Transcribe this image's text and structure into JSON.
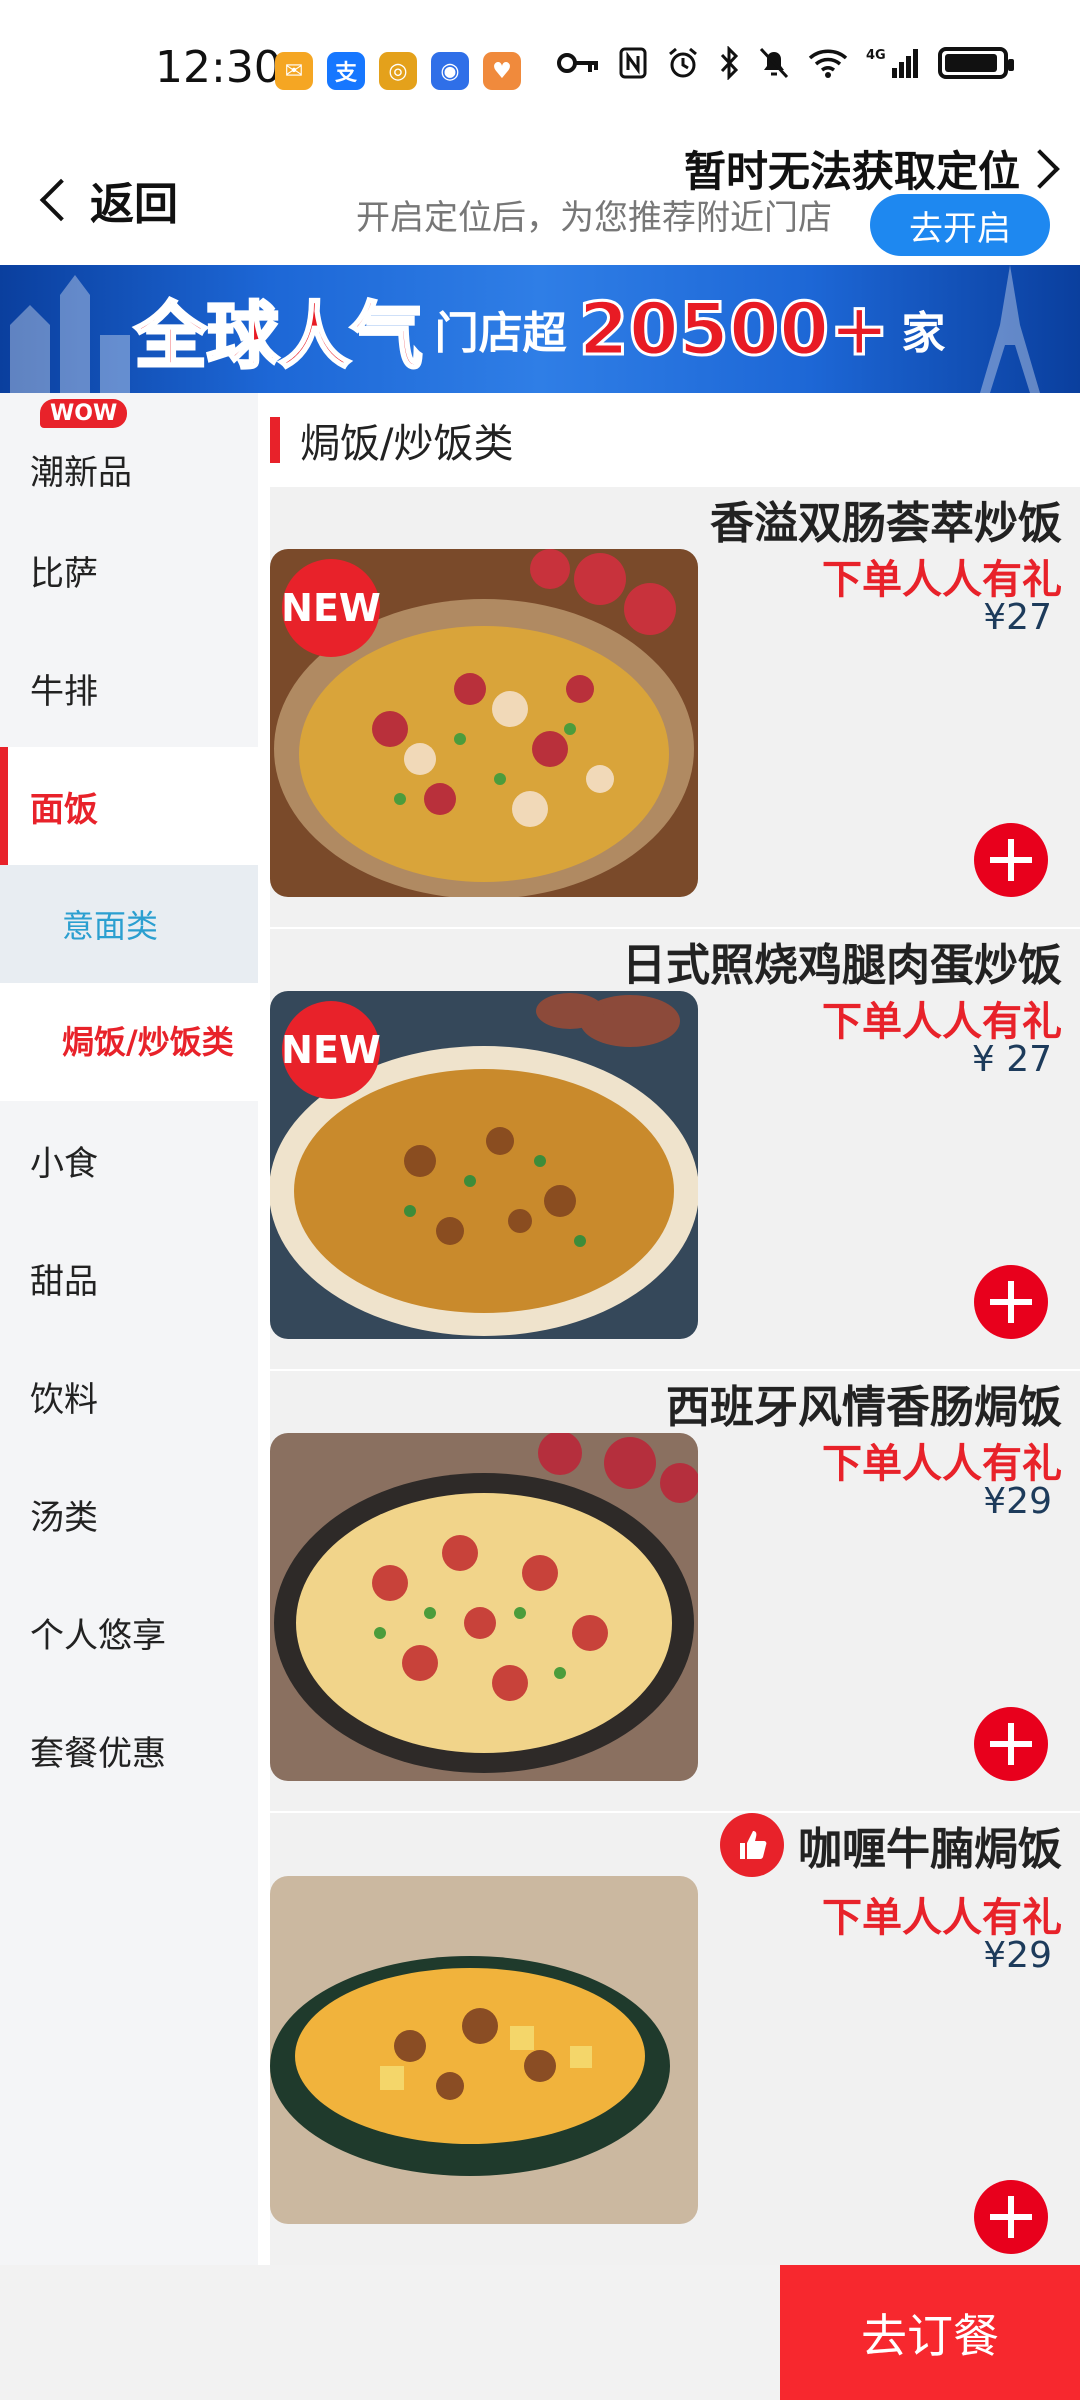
{
  "status_bar": {
    "time": "12:30",
    "app_icons": [
      {
        "name": "mail-notification-icon",
        "glyph": "✉",
        "color": "#f5a623"
      },
      {
        "name": "alipay-icon",
        "glyph": "支",
        "color": "#1677ff"
      },
      {
        "name": "app-notification-icon",
        "glyph": "◎",
        "color": "#e4a11b"
      },
      {
        "name": "security-app-icon",
        "glyph": "◉",
        "color": "#2f6fe8"
      },
      {
        "name": "health-app-icon",
        "glyph": "♥",
        "color": "#f08a3c"
      }
    ],
    "network": "4G"
  },
  "header": {
    "back_label": "返回",
    "location_title": "暂时无法获取定位",
    "location_hint": "开启定位后，为您推荐附近门店",
    "enable_button": "去开启"
  },
  "banner": {
    "headline": "全球人气",
    "mid_text": "门店超",
    "number": "20500+",
    "suffix": "家"
  },
  "sidebar": {
    "items": [
      {
        "label": "潮新品",
        "badge": "WOW"
      },
      {
        "label": "比萨"
      },
      {
        "label": "牛排"
      },
      {
        "label": "面饭",
        "active": true
      }
    ],
    "sub_items": [
      {
        "label": "意面类"
      },
      {
        "label": "焗饭/炒饭类",
        "active": true
      }
    ],
    "items_after": [
      {
        "label": "小食"
      },
      {
        "label": "甜品"
      },
      {
        "label": "饮料"
      },
      {
        "label": "汤类"
      },
      {
        "label": "个人悠享"
      },
      {
        "label": "套餐优惠"
      }
    ]
  },
  "content": {
    "section_title": "焗饭/炒饭类",
    "products": [
      {
        "name": "香溢双肠荟萃炒饭",
        "promo": "下单人人有礼",
        "price": "¥27",
        "badge": "NEW"
      },
      {
        "name": "日式照烧鸡腿肉蛋炒饭",
        "promo": "下单人人有礼",
        "price": "¥ 27",
        "badge": "NEW"
      },
      {
        "name": "西班牙风情香肠焗饭",
        "promo": "下单人人有礼",
        "price": "¥29",
        "badge": ""
      },
      {
        "name": "咖喱牛腩焗饭",
        "promo": "下单人人有礼",
        "price": "¥29",
        "badge": "",
        "recommended": true
      }
    ]
  },
  "bottom_bar": {
    "order_button": "去订餐"
  },
  "colors": {
    "brand_red": "#e8222a",
    "accent_blue": "#1e88f0",
    "sub_active_blue": "#2b9fd0"
  }
}
